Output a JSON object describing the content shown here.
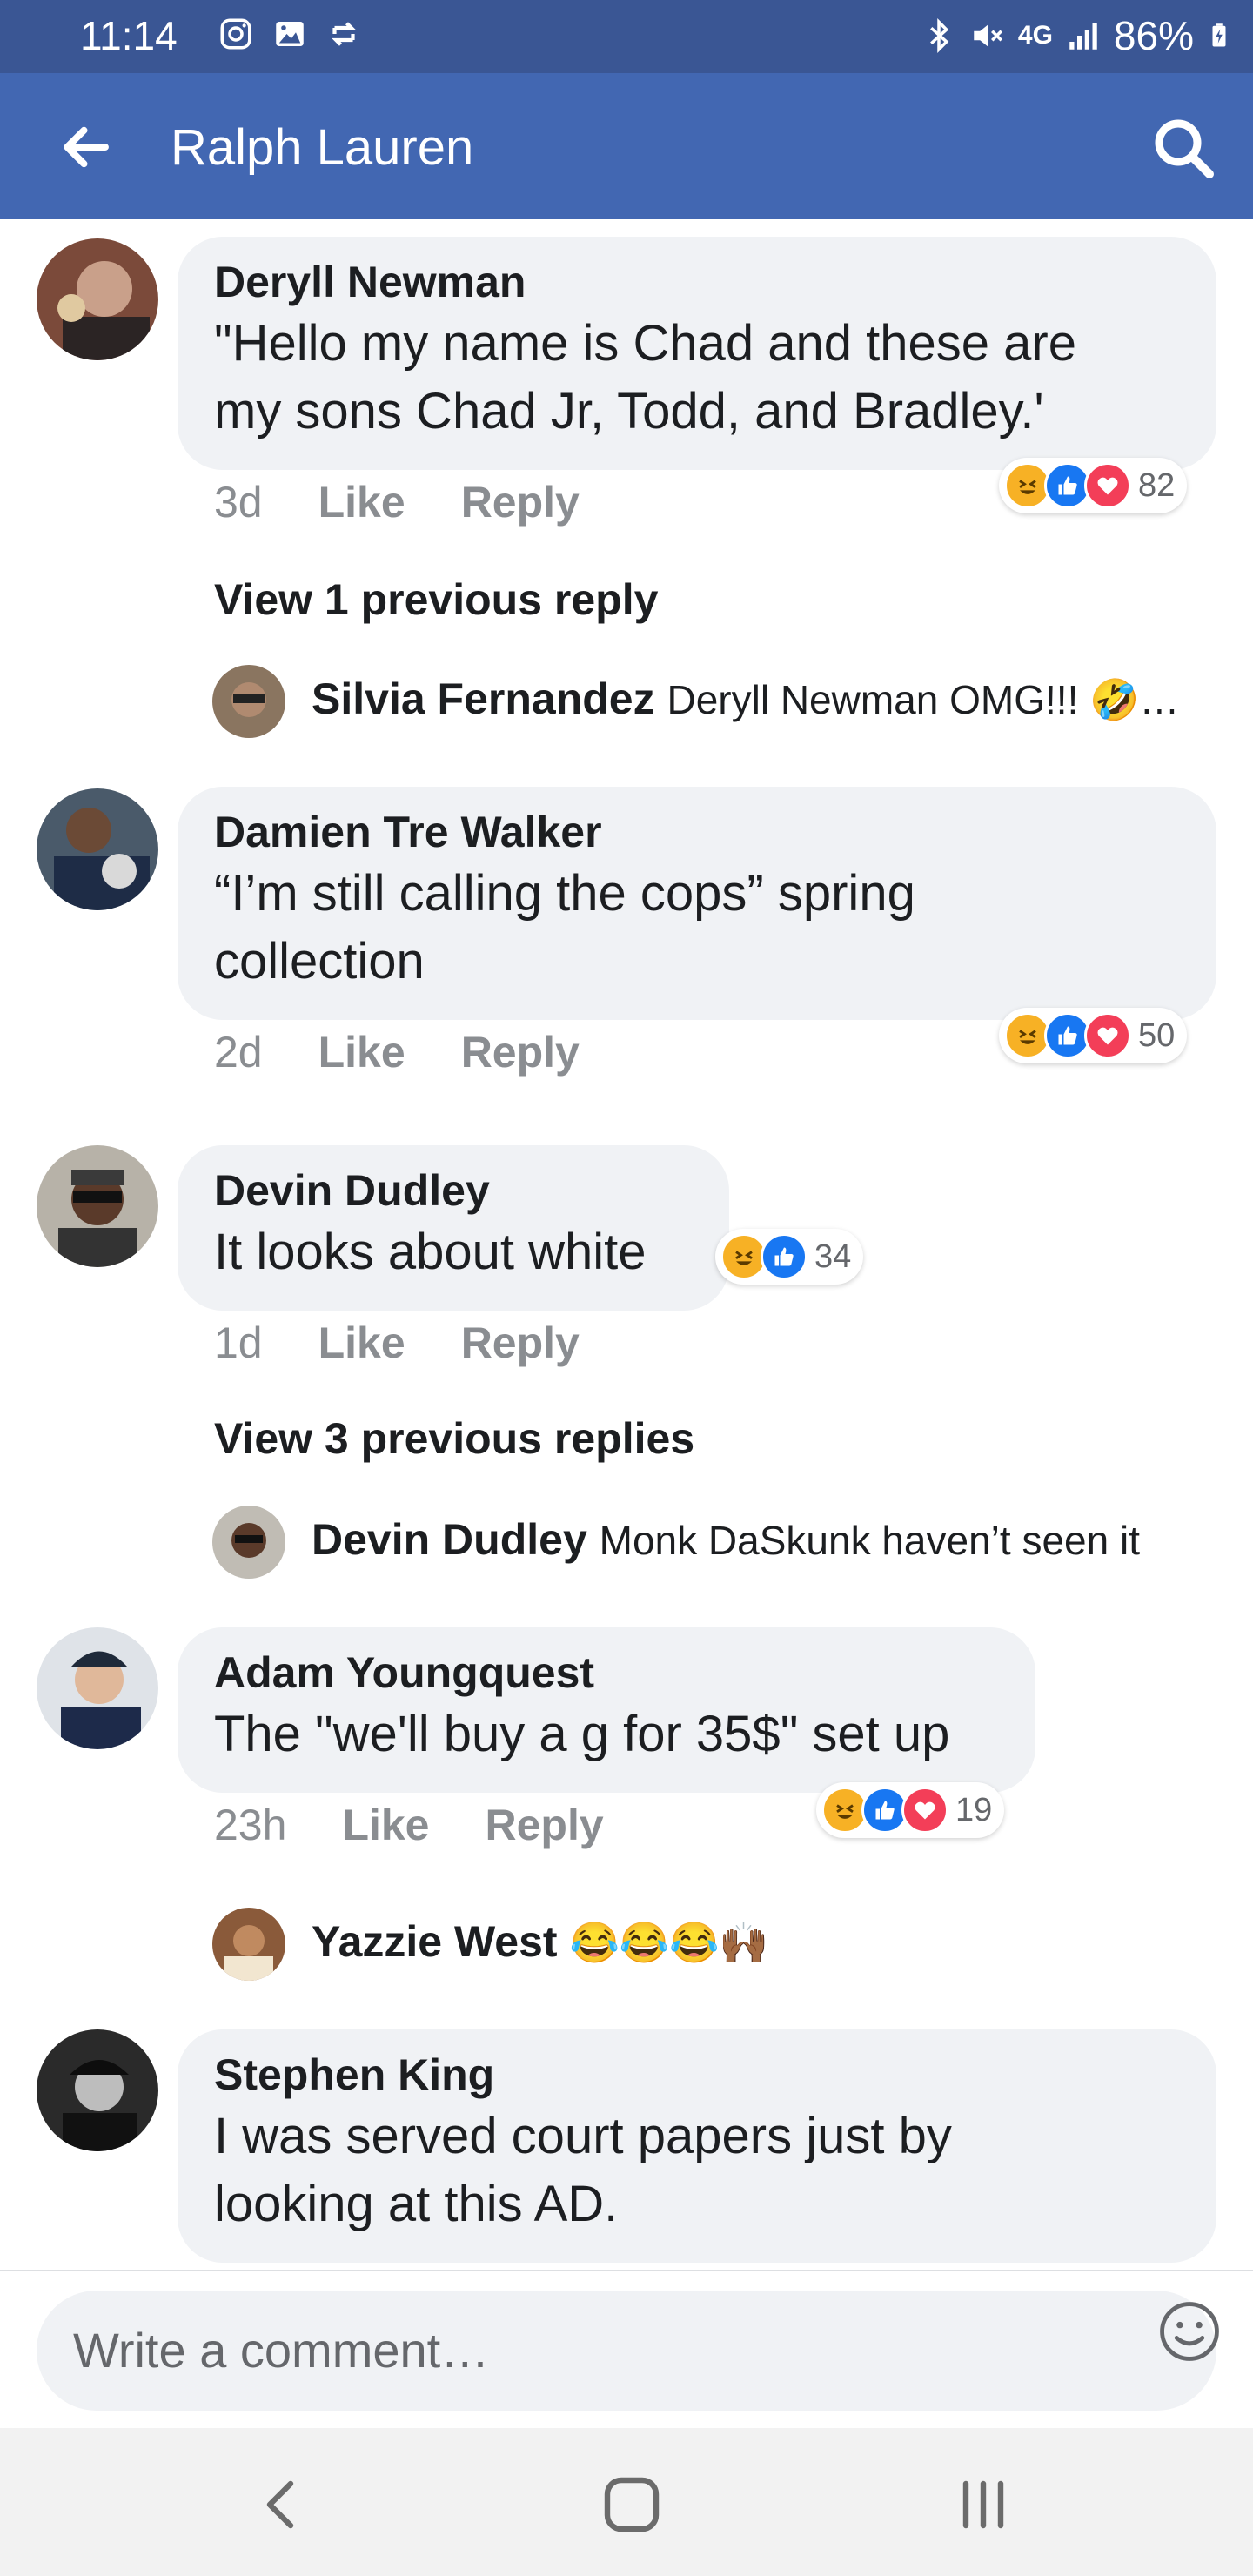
{
  "status_bar": {
    "time": "11:14",
    "battery": "86%",
    "network": "4G",
    "icons": [
      "instagram-icon",
      "gallery-icon",
      "sync-icon",
      "bluetooth-icon",
      "mute-icon",
      "signal-icon",
      "battery-icon"
    ]
  },
  "app_bar": {
    "title": "Ralph Lauren",
    "back_icon": "arrow-left-icon",
    "search_icon": "search-icon",
    "bg_color": "#4267b2"
  },
  "comments": [
    {
      "author": "Deryll Newman",
      "text_line1": "\"Hello my name is Chad and these are",
      "text_line2": "my sons Chad Jr, Todd, and Bradley.'",
      "age": "3d",
      "like": "Like",
      "reply": "Reply",
      "reactions": [
        "haha",
        "like",
        "love"
      ],
      "reaction_count": "82",
      "view_replies": "View 1 previous reply",
      "reply_preview": {
        "author": "Silvia Fernandez",
        "text": "Deryll Newman OMG!!! 🤣…"
      }
    },
    {
      "author": "Damien Tre Walker",
      "text_line1": "“I’m still calling the cops” spring",
      "text_line2": "collection",
      "age": "2d",
      "like": "Like",
      "reply": "Reply",
      "reactions": [
        "haha",
        "like",
        "love"
      ],
      "reaction_count": "50"
    },
    {
      "author": "Devin Dudley",
      "text_line1": "It looks about white",
      "age": "1d",
      "like": "Like",
      "reply": "Reply",
      "reactions": [
        "haha",
        "like"
      ],
      "reaction_count": "34",
      "view_replies": "View 3 previous replies",
      "reply_preview": {
        "author": "Devin Dudley",
        "text": "Monk DaSkunk haven’t seen it"
      }
    },
    {
      "author": "Adam Youngquest",
      "text_line1": "The \"we'll buy a g for 35$\" set up",
      "age": "23h",
      "like": "Like",
      "reply": "Reply",
      "reactions": [
        "haha",
        "like",
        "love"
      ],
      "reaction_count": "19",
      "reply_preview": {
        "author": "Yazzie West",
        "text": "😂😂😂🙌🏾"
      }
    },
    {
      "author": "Stephen King",
      "text_line1": "I was served court papers just by",
      "text_line2": "looking at this AD."
    }
  ],
  "composer": {
    "placeholder": "Write a comment…",
    "emoji_icon": "smiley-icon"
  },
  "nav_bar": {
    "icons": [
      "nav-back-icon",
      "nav-home-icon",
      "nav-recents-icon"
    ]
  }
}
